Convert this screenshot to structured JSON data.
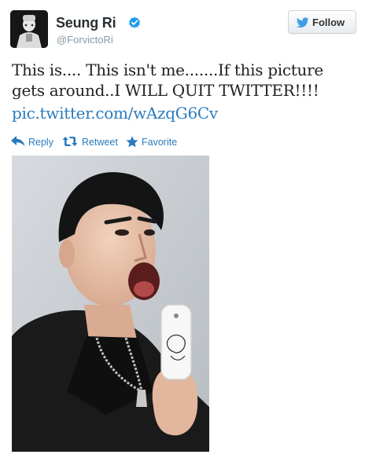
{
  "user": {
    "name": "Seung Ri",
    "handle": "@ForvictoRi",
    "verified": true
  },
  "follow_button": {
    "label": "Follow"
  },
  "tweet": {
    "text": "This is.... This isn't me.......If this picture gets around..I WILL QUIT TWITTER!!!!",
    "link": "pic.twitter.com/wAzqG6Cv"
  },
  "actions": {
    "reply": "Reply",
    "retweet": "Retweet",
    "favorite": "Favorite"
  },
  "colors": {
    "link": "#2a7bbd",
    "verified": "#1d9bf0",
    "twitter_bird": "#3ba0e3"
  },
  "icons": [
    "verified-badge-icon",
    "twitter-bird-icon",
    "reply-icon",
    "retweet-icon",
    "star-icon"
  ]
}
